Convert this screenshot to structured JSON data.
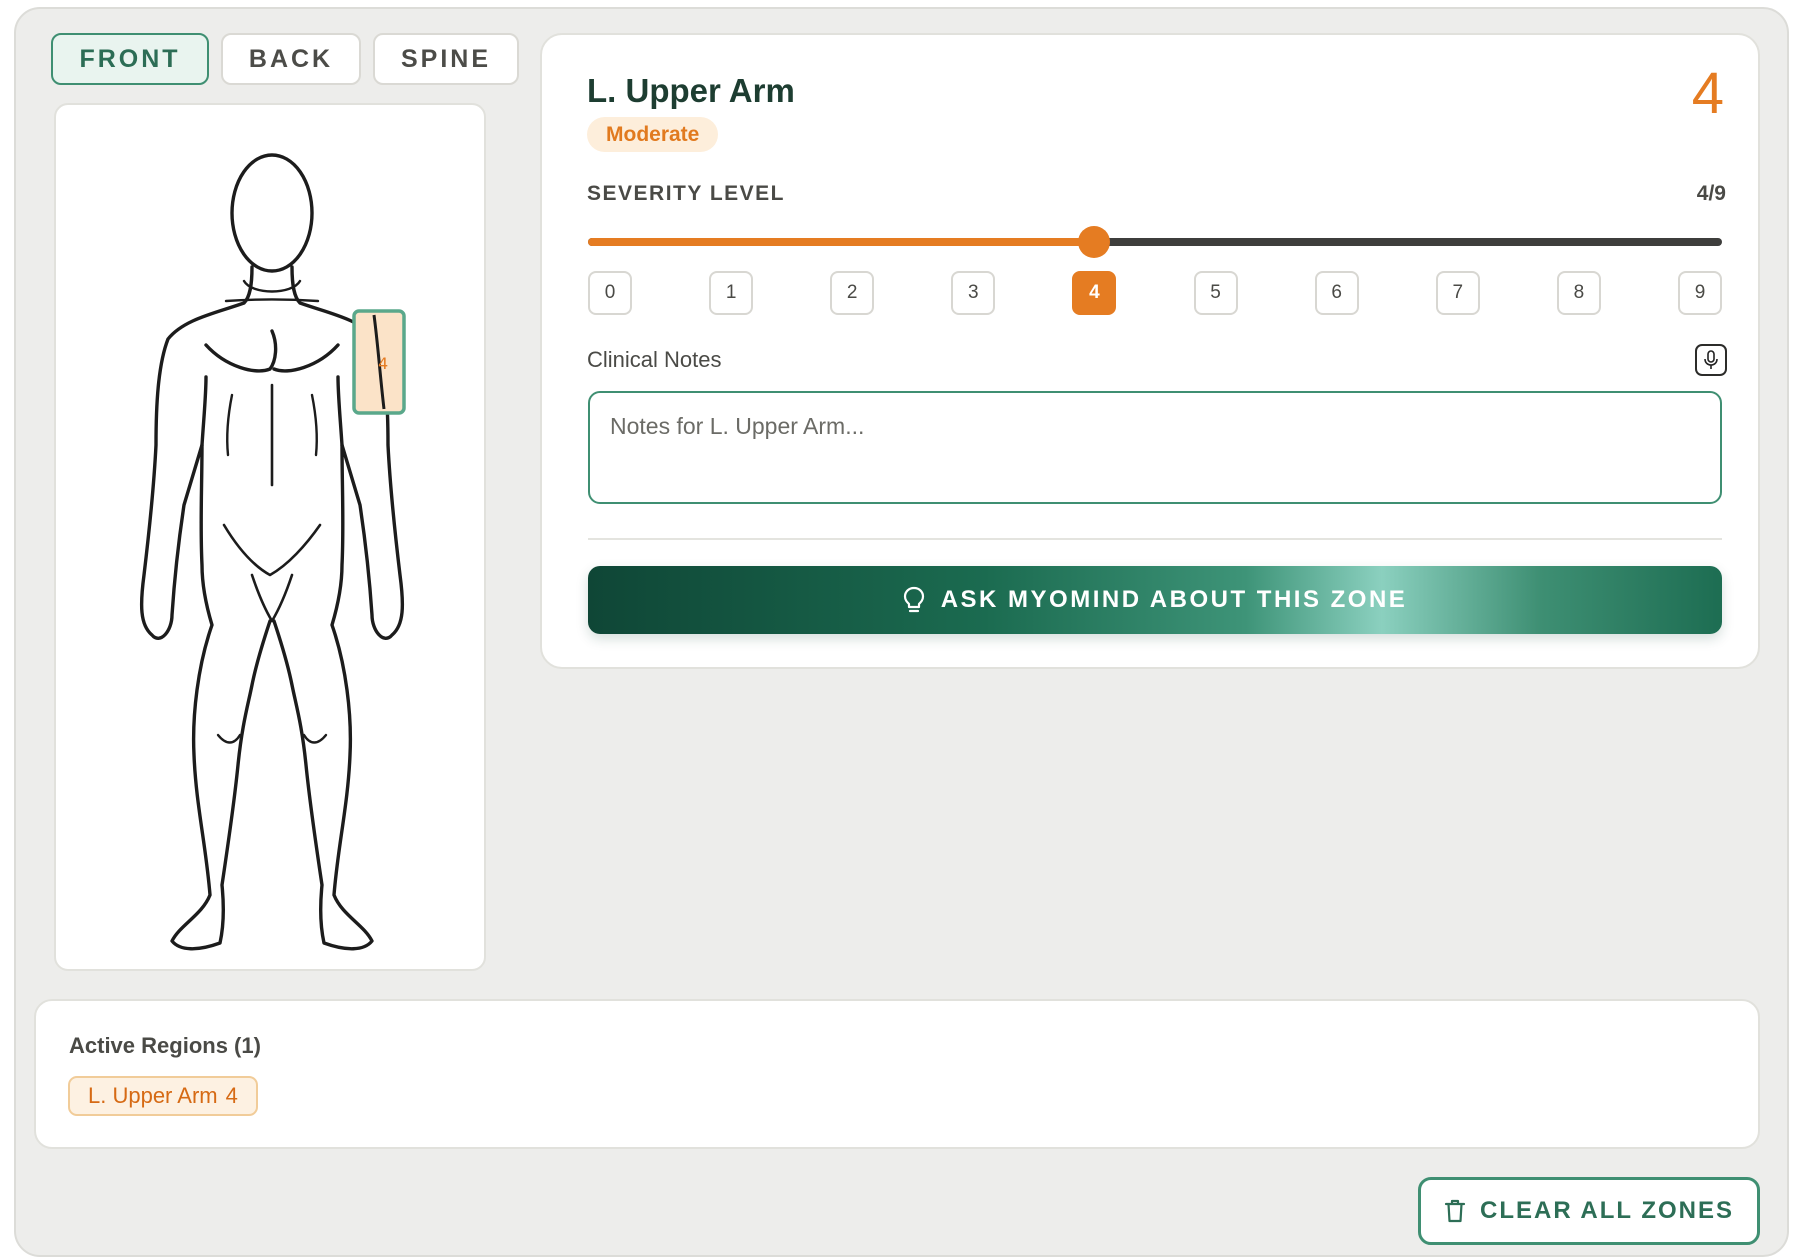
{
  "view_tabs": [
    {
      "label": "FRONT",
      "active": true
    },
    {
      "label": "BACK",
      "active": false
    },
    {
      "label": "SPINE",
      "active": false
    }
  ],
  "body_map": {
    "selected_zone_marker": "4"
  },
  "detail": {
    "zone_name": "L. Upper Arm",
    "severity_text": "Moderate",
    "score": "4",
    "severity_label": "SEVERITY LEVEL",
    "severity_fraction": "4/9",
    "severity_value": 4,
    "severity_max": 9,
    "levels": [
      "0",
      "1",
      "2",
      "3",
      "4",
      "5",
      "6",
      "7",
      "8",
      "9"
    ],
    "notes_label": "Clinical Notes",
    "notes_placeholder": "Notes for L. Upper Arm...",
    "notes_value": "",
    "ask_button_label": "ASK MYOMIND ABOUT THIS ZONE"
  },
  "regions": {
    "title": "Active Regions (1)",
    "chips": [
      {
        "name": "L. Upper Arm",
        "score": "4"
      }
    ]
  },
  "clear_button_label": "CLEAR ALL ZONES",
  "colors": {
    "accent_green": "#3f8f72",
    "accent_orange": "#e57c22",
    "badge_bg": "#fdeedb"
  },
  "icons": {
    "ask_button": "lightbulb-icon",
    "notes": "microphone-icon",
    "clear_button": "trash-icon"
  }
}
